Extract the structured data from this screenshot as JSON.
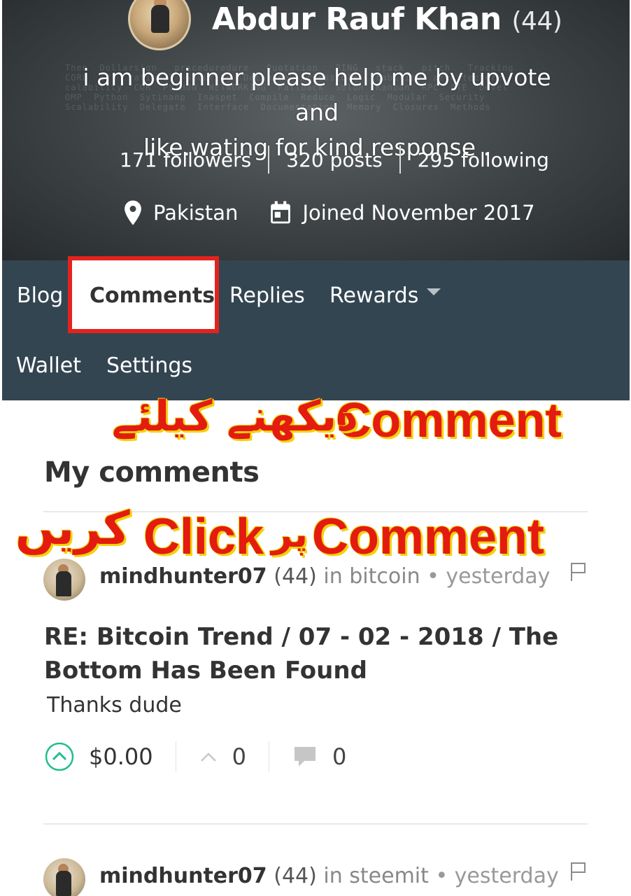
{
  "profile": {
    "name": "Abdur Rauf Khan",
    "reputation": "(44)",
    "about_line1": "i am beginner please help me by upvote and",
    "about_line2": "like.wating for kind response .",
    "followers": "171 followers",
    "posts": "320 posts",
    "following": "295 following",
    "location": "Pakistan",
    "joined": "Joined November 2017"
  },
  "nav": {
    "tabs": [
      {
        "label": "Blog"
      },
      {
        "label": "Comments"
      },
      {
        "label": "Replies"
      },
      {
        "label": "Rewards"
      },
      {
        "label": "Wallet"
      },
      {
        "label": "Settings"
      }
    ],
    "active_tab": "Comments"
  },
  "overlay": {
    "line1_en": "Comment",
    "line1_ur": "دیکھنے کیلئے",
    "line2_en_click": "Click",
    "line2_ur_par": "پر",
    "line2_en_comment": "Comment",
    "line2_ur_karein": "کریں"
  },
  "main": {
    "section_title": "My comments",
    "comments": [
      {
        "author": "mindhunter07",
        "reputation": "(44)",
        "category": "in bitcoin",
        "time": "• yesterday",
        "title": "RE: Bitcoin Trend / 07 - 02 - 2018 / The Bottom Has Been Found",
        "body": "Thanks dude",
        "payout": "$0.00",
        "votes": "0",
        "replies": "0"
      },
      {
        "author": "mindhunter07",
        "reputation": "(44)",
        "category": "in steemit",
        "time": "• yesterday"
      }
    ]
  },
  "colors": {
    "nav_bg": "#344552",
    "highlight_border": "#e3231d",
    "overlay_text": "#e31b10",
    "overlay_shadow": "#f2d20c",
    "upvote_green": "#1fbf8f"
  }
}
